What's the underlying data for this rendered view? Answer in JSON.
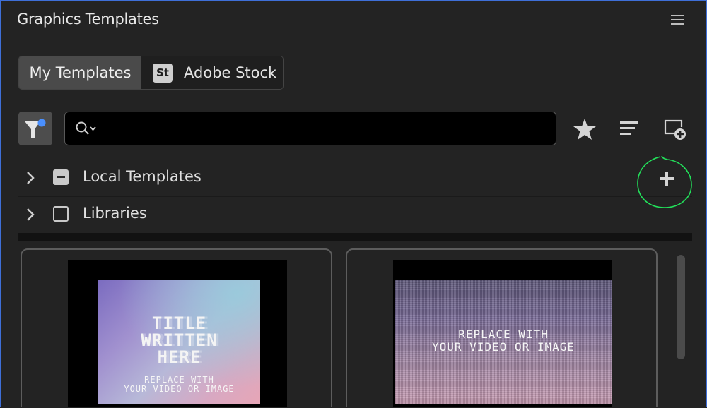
{
  "panel": {
    "title": "Graphics Templates",
    "menu_icon": "hamburger-menu-icon"
  },
  "tabs": [
    {
      "label": "My Templates",
      "active": true
    },
    {
      "label": "Adobe Stock",
      "badge": "St",
      "active": false
    }
  ],
  "toolbar": {
    "filter_icon": "filter-icon",
    "search": {
      "value": "",
      "placeholder": "",
      "icon": "search-icon"
    },
    "favorites_icon": "star-icon",
    "sort_icon": "sort-lines-icon",
    "new_item_icon": "new-item-icon"
  },
  "sources": [
    {
      "label": "Local Templates",
      "checkbox": "mixed"
    },
    {
      "label": "Libraries",
      "checkbox": "unchecked"
    }
  ],
  "add_button_icon": "plus-icon",
  "templates": [
    {
      "title_lines": [
        "TITLE",
        "WRITTEN",
        "HERE"
      ],
      "caption_lines": [
        "REPLACE WITH",
        "YOUR VIDEO OR IMAGE"
      ]
    },
    {
      "caption_lines": [
        "REPLACE WITH",
        "YOUR VIDEO OR IMAGE"
      ]
    }
  ],
  "colors": {
    "panel_border": "#3e6fd8",
    "annotation": "#22e05a",
    "filter_dot": "#4a90ff"
  }
}
